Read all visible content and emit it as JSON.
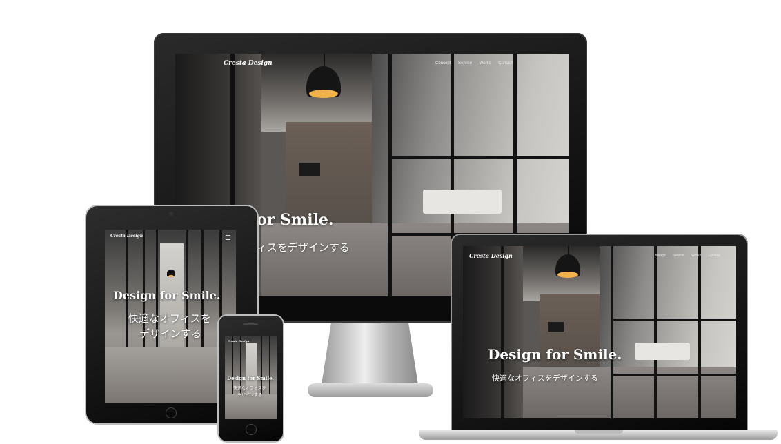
{
  "site": {
    "brand": "Cresta Design",
    "nav": [
      "Concept",
      "Service",
      "Works",
      "Contact"
    ],
    "hero_en": "Design for Smile.",
    "hero_en_cropped": "n for Smile.",
    "hero_ja": "快適なオフィスをデザインする",
    "hero_ja_cropped": "ォフィスをデザインする",
    "tablet_ja_line1": "快適なオフィスを",
    "tablet_ja_line2": "デザインする",
    "phone_ja_line1": "快適なオフィスを",
    "phone_ja_line2": "デザインする"
  },
  "colors": {
    "bezel": "#111111",
    "lamp_glow": "#f1b24a",
    "stand_silver": "#c9c9c9"
  }
}
